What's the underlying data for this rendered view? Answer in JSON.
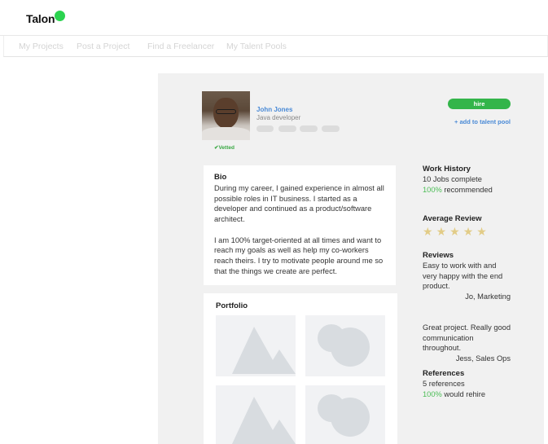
{
  "header": {
    "logo_text": "Talon",
    "logo_dot_color": "#2bd34f"
  },
  "nav": {
    "items": [
      "My Projects",
      "Post a Project",
      "Find a Freelancer",
      "My Talent Pools"
    ]
  },
  "profile": {
    "name": "John Jones",
    "title": "Java developer",
    "vetted_label": "Vetted",
    "vetted_icon": "check-icon",
    "tag_count": 4
  },
  "actions": {
    "hire_label": "hire",
    "hire_color": "#33b54a",
    "add_pool_label": "+ add to talent pool"
  },
  "bio": {
    "title": "Bio",
    "paragraphs": [
      "During my career, I gained experience in almost all possible roles in IT business. I started as a developer and continued as a product/software architect.",
      "I am 100% target-oriented at all times and want to reach my goals as well as help my co-workers reach theirs. I try to motivate people around me so that the things we create are perfect."
    ]
  },
  "portfolio": {
    "title": "Portfolio",
    "items": [
      "mountain-placeholder-icon",
      "circles-placeholder-icon",
      "mountain-placeholder-icon",
      "circles-placeholder-icon"
    ]
  },
  "work_history": {
    "title": "Work History",
    "jobs_complete": "10 Jobs complete",
    "recommended_pct": "100%",
    "recommended_label": " recommended"
  },
  "average_review": {
    "title": "Average Review",
    "rating": 5,
    "max": 5,
    "star_color": "#e2cc87"
  },
  "reviews": {
    "title": "Reviews",
    "items": [
      {
        "text": "Easy to work with and very happy with the end product.",
        "author": "Jo, Marketing"
      },
      {
        "text": "Great project. Really good communication throughout.",
        "author": "Jess, Sales Ops"
      }
    ]
  },
  "references": {
    "title": "References",
    "count_text": "5 references",
    "rehire_pct": "100%",
    "rehire_label": " would rehire"
  }
}
